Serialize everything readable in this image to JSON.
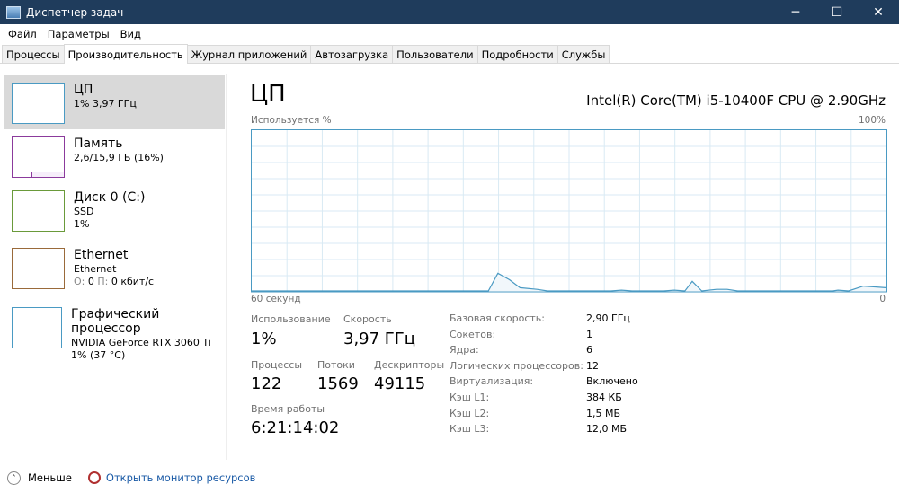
{
  "window": {
    "title": "Диспетчер задач",
    "minimize": "─",
    "maximize": "☐",
    "close": "✕"
  },
  "menu": [
    "Файл",
    "Параметры",
    "Вид"
  ],
  "tabs": [
    "Процессы",
    "Производительность",
    "Журнал приложений",
    "Автозагрузка",
    "Пользователи",
    "Подробности",
    "Службы"
  ],
  "active_tab": 1,
  "sidebar": [
    {
      "name": "ЦП",
      "line1": "1% 3,97 ГГц",
      "line2": "",
      "color": "#4a9ac3"
    },
    {
      "name": "Память",
      "line1": "2,6/15,9 ГБ (16%)",
      "line2": "",
      "color": "#8b3a9c"
    },
    {
      "name": "Диск 0 (C:)",
      "line1": "SSD",
      "line2": "1%",
      "color": "#6a9a3a"
    },
    {
      "name": "Ethernet",
      "line1": "Ethernet",
      "line2": "",
      "color": "#9a6a3a"
    },
    {
      "name": "Графический процессор",
      "line1": "NVIDIA GeForce RTX 3060 Ti",
      "line2": "1% (37 °C)",
      "color": "#4a9ac3"
    }
  ],
  "ethernet_rates": {
    "send_label": "О:",
    "send": "0",
    "recv_label": "П:",
    "recv": "0 кбит/с"
  },
  "main": {
    "title": "ЦП",
    "cpu_name": "Intel(R) Core(TM) i5-10400F CPU @ 2.90GHz"
  },
  "chart_data": {
    "type": "area",
    "ylabel": "Используется %",
    "ymax_label": "100%",
    "xlabel_left": "60 секунд",
    "xlabel_right": "0",
    "ylim": [
      0,
      100
    ],
    "xlim": [
      60,
      0
    ],
    "grid": true,
    "color": "#4a9ac3",
    "points": [
      [
        60,
        0
      ],
      [
        38,
        0
      ],
      [
        37.6,
        0
      ],
      [
        36.7,
        11
      ],
      [
        35.6,
        7
      ],
      [
        34.6,
        2
      ],
      [
        33,
        1
      ],
      [
        32,
        0
      ],
      [
        26,
        0
      ],
      [
        25,
        0.5
      ],
      [
        24,
        0
      ],
      [
        21,
        0
      ],
      [
        20,
        0.5
      ],
      [
        19,
        0
      ],
      [
        18.3,
        6
      ],
      [
        17.4,
        0
      ],
      [
        16,
        1
      ],
      [
        15,
        1
      ],
      [
        14,
        0
      ],
      [
        5,
        0
      ],
      [
        4.5,
        0.5
      ],
      [
        3.5,
        0
      ],
      [
        2.1,
        3
      ],
      [
        1,
        2.5
      ],
      [
        0,
        2
      ]
    ]
  },
  "stats": {
    "usage_label": "Использование",
    "usage": "1%",
    "speed_label": "Скорость",
    "speed": "3,97 ГГц",
    "processes_label": "Процессы",
    "processes": "122",
    "threads_label": "Потоки",
    "threads": "1569",
    "handles_label": "Дескрипторы",
    "handles": "49115",
    "uptime_label": "Время работы",
    "uptime": "6:21:14:02"
  },
  "specs": [
    [
      "Базовая скорость:",
      "2,90 ГГц"
    ],
    [
      "Сокетов:",
      "1"
    ],
    [
      "Ядра:",
      "6"
    ],
    [
      "Логических процессоров:",
      "12"
    ],
    [
      "Виртуализация:",
      "Включено"
    ],
    [
      "Кэш L1:",
      "384 КБ"
    ],
    [
      "Кэш L2:",
      "1,5 МБ"
    ],
    [
      "Кэш L3:",
      "12,0 МБ"
    ]
  ],
  "footer": {
    "less": "Меньше",
    "monitor": "Открыть монитор ресурсов"
  }
}
